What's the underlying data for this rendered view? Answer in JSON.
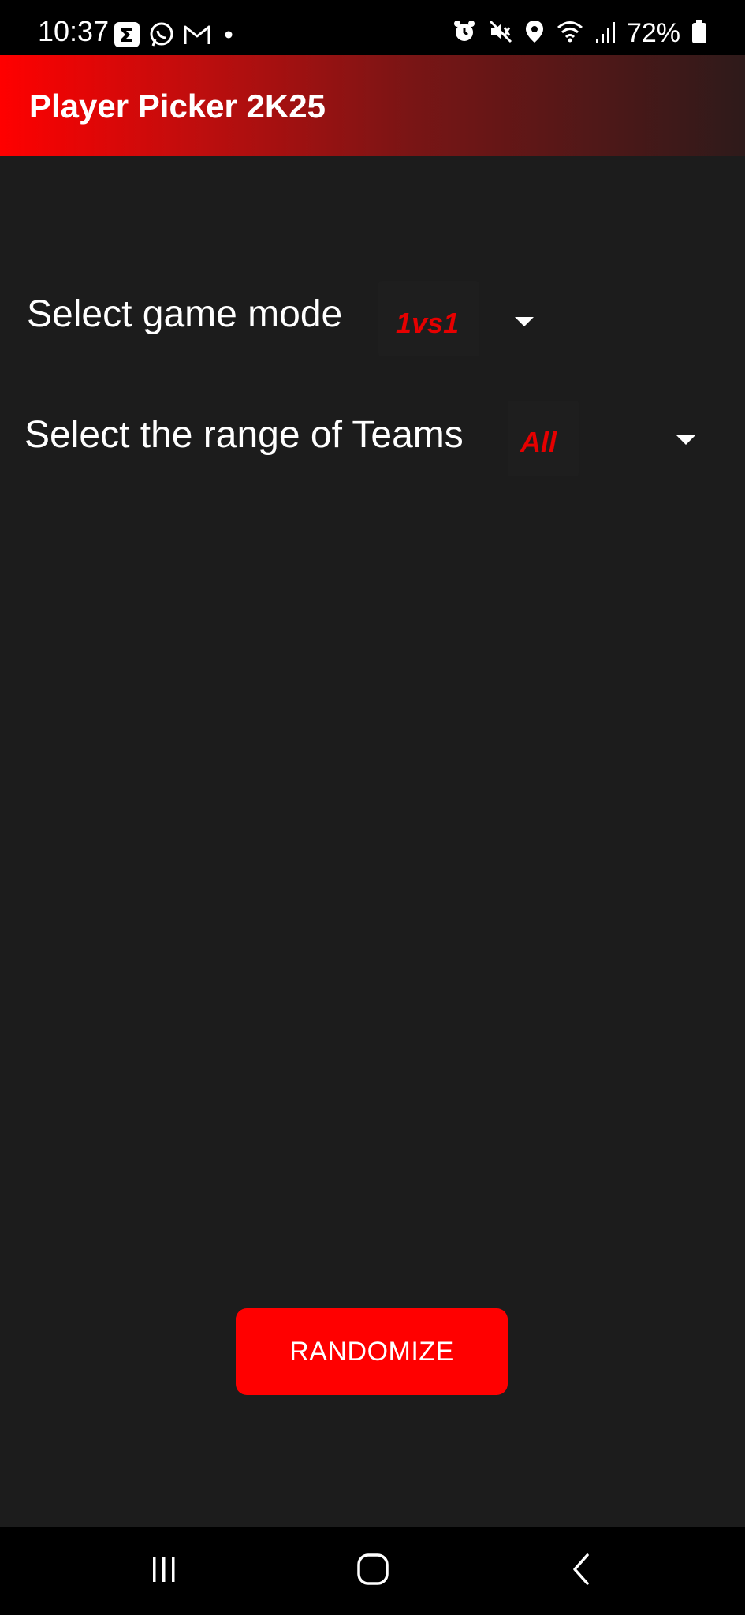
{
  "status_bar": {
    "time": "10:37",
    "left_icons": [
      "sigma-icon",
      "whatsapp-icon",
      "gmail-icon",
      "dot-icon"
    ],
    "right_icons": [
      "alarm-icon",
      "mute-icon",
      "location-icon",
      "wifi-icon",
      "signal-icon",
      "battery-icon"
    ],
    "battery": "72%"
  },
  "app_bar": {
    "title": "Player Picker 2K25"
  },
  "game_mode": {
    "label": "Select game mode",
    "selected": "1vs1"
  },
  "team_range": {
    "label": "Select the range of Teams",
    "selected": "All"
  },
  "randomize_button": {
    "label": "RANDOMIZE"
  },
  "nav_bar": {
    "items": [
      "recent-apps-icon",
      "home-icon",
      "back-icon"
    ]
  },
  "colors": {
    "accent": "#ff0000",
    "background": "#1c1c1c",
    "value_text": "#e60000"
  }
}
